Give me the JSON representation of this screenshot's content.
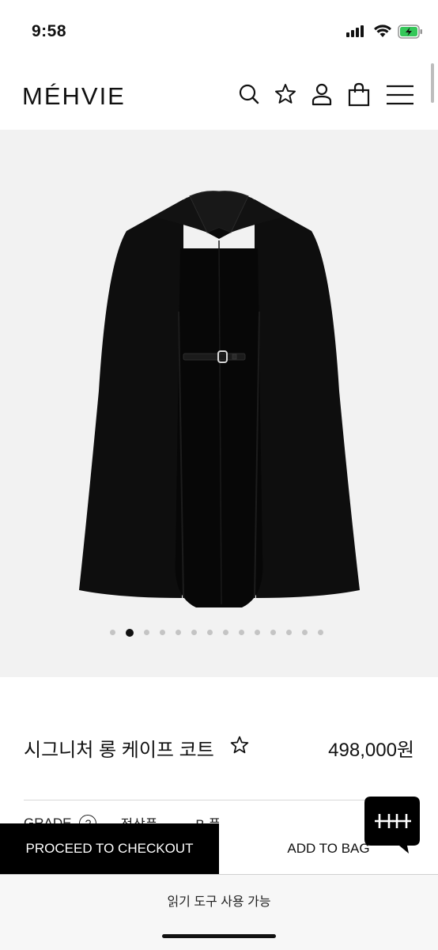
{
  "status_bar": {
    "time": "9:58"
  },
  "header": {
    "brand": "MÉHVIE",
    "icons": [
      "search-icon",
      "star-icon",
      "user-icon",
      "bag-icon",
      "menu-icon"
    ]
  },
  "gallery": {
    "image_count": 14,
    "active_index": 1
  },
  "product": {
    "name": "시그니처 롱 케이프 코트",
    "price": "498,000원"
  },
  "grade": {
    "label": "GRADE",
    "help": "?",
    "value_1": "정상품",
    "value_2": "B 품"
  },
  "actions": {
    "checkout": "PROCEED TO CHECKOUT",
    "add_to_bag": "ADD TO BAG"
  },
  "chat": {
    "logo_text": "H H"
  },
  "reader": {
    "text": "읽기 도구 사용 가능"
  },
  "colors": {
    "accent": "#000000",
    "image_bg": "#f2f2f2"
  }
}
